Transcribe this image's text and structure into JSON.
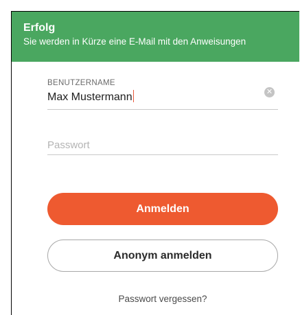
{
  "banner": {
    "title": "Erfolg",
    "message": "Sie werden in Kürze eine E-Mail mit den Anweisungen",
    "color": "#4aa760"
  },
  "username": {
    "label": "BENUTZERNAME",
    "value": "Max Mustermann",
    "clear_icon": "clear-icon"
  },
  "password": {
    "placeholder": "Passwort",
    "value": ""
  },
  "buttons": {
    "login_label": "Anmelden",
    "login_color": "#ee5a30",
    "anonymous_label": "Anonym anmelden"
  },
  "links": {
    "forgot_password": "Passwort vergessen?"
  }
}
